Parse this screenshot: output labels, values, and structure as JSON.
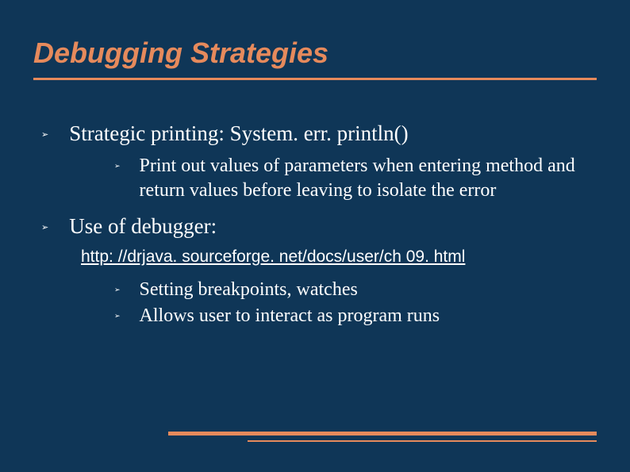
{
  "title": "Debugging Strategies",
  "items": [
    {
      "text": "Strategic printing: System. err. println()",
      "sub": [
        "Print out values of parameters when entering method and return values before leaving to isolate the error"
      ]
    },
    {
      "text": "Use of debugger:",
      "link": "http: //drjava. sourceforge. net/docs/user/ch 09. html",
      "sub2": [
        "Setting breakpoints, watches",
        "Allows user to interact as program runs"
      ]
    }
  ]
}
